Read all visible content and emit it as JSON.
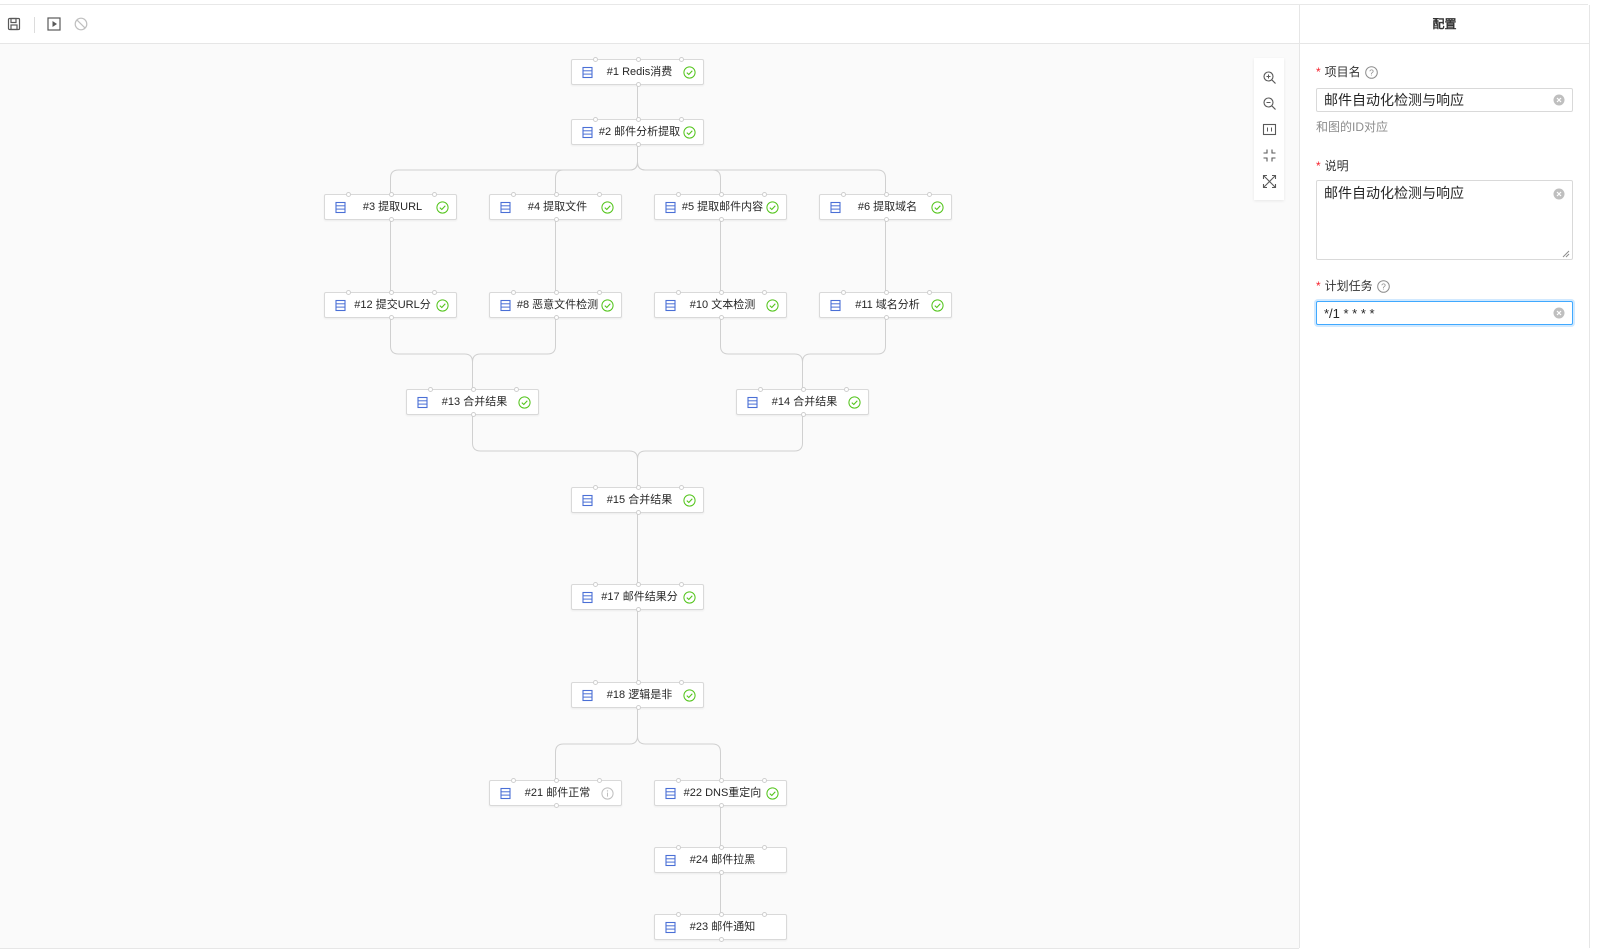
{
  "toolbar": {
    "buttons": [
      {
        "name": "save-icon"
      },
      {
        "name": "run-icon"
      },
      {
        "name": "disable-icon"
      }
    ]
  },
  "workflow": {
    "nodes": [
      {
        "id": "n1",
        "label": "#1 Redis消费",
        "status": "success"
      },
      {
        "id": "n2",
        "label": "#2 邮件分析提取",
        "status": "success"
      },
      {
        "id": "n3",
        "label": "#3 提取URL",
        "status": "success"
      },
      {
        "id": "n4",
        "label": "#4 提取文件",
        "status": "success"
      },
      {
        "id": "n5",
        "label": "#5 提取邮件内容",
        "status": "success"
      },
      {
        "id": "n6",
        "label": "#6 提取域名",
        "status": "success"
      },
      {
        "id": "n12",
        "label": "#12 提交URL分",
        "status": "success"
      },
      {
        "id": "n8",
        "label": "#8 恶意文件检测",
        "status": "success"
      },
      {
        "id": "n10",
        "label": "#10 文本检测",
        "status": "success"
      },
      {
        "id": "n11",
        "label": "#11 域名分析",
        "status": "success"
      },
      {
        "id": "n13",
        "label": "#13 合并结果",
        "status": "success"
      },
      {
        "id": "n14",
        "label": "#14 合并结果",
        "status": "success"
      },
      {
        "id": "n15",
        "label": "#15 合并结果",
        "status": "success"
      },
      {
        "id": "n17",
        "label": "#17 邮件结果分",
        "status": "success"
      },
      {
        "id": "n18",
        "label": "#18 逻辑是非",
        "status": "success"
      },
      {
        "id": "n21",
        "label": "#21 邮件正常",
        "status": "info"
      },
      {
        "id": "n22",
        "label": "#22 DNS重定向",
        "status": "success"
      },
      {
        "id": "n24",
        "label": "#24 邮件拉黑",
        "status": "none"
      },
      {
        "id": "n23",
        "label": "#23 邮件通知",
        "status": "none"
      }
    ],
    "edges": [
      [
        "n1",
        "n2"
      ],
      [
        "n2",
        "n3"
      ],
      [
        "n2",
        "n4"
      ],
      [
        "n2",
        "n5"
      ],
      [
        "n2",
        "n6"
      ],
      [
        "n3",
        "n12"
      ],
      [
        "n4",
        "n8"
      ],
      [
        "n5",
        "n10"
      ],
      [
        "n6",
        "n11"
      ],
      [
        "n12",
        "n13"
      ],
      [
        "n8",
        "n13"
      ],
      [
        "n10",
        "n14"
      ],
      [
        "n11",
        "n14"
      ],
      [
        "n13",
        "n15"
      ],
      [
        "n14",
        "n15"
      ],
      [
        "n15",
        "n17"
      ],
      [
        "n17",
        "n18"
      ],
      [
        "n18",
        "n21"
      ],
      [
        "n18",
        "n22"
      ],
      [
        "n22",
        "n24"
      ],
      [
        "n24",
        "n23"
      ]
    ],
    "zoom_controls": [
      "zoom-in-icon",
      "zoom-out-icon",
      "fit-view-icon",
      "collapse-icon",
      "fullscreen-icon"
    ]
  },
  "panel": {
    "title": "配置",
    "project_name": {
      "label": "项目名",
      "value": "邮件自动化检测与响应",
      "hint": "和图的ID对应"
    },
    "description": {
      "label": "说明",
      "value": "邮件自动化检测与响应"
    },
    "schedule": {
      "label": "计划任务",
      "value": "*/1 * * * *"
    }
  },
  "colors": {
    "accent": "#1890ff",
    "success": "#52c41a",
    "node_icon": "#4a6fd6",
    "required": "#f5222d"
  }
}
